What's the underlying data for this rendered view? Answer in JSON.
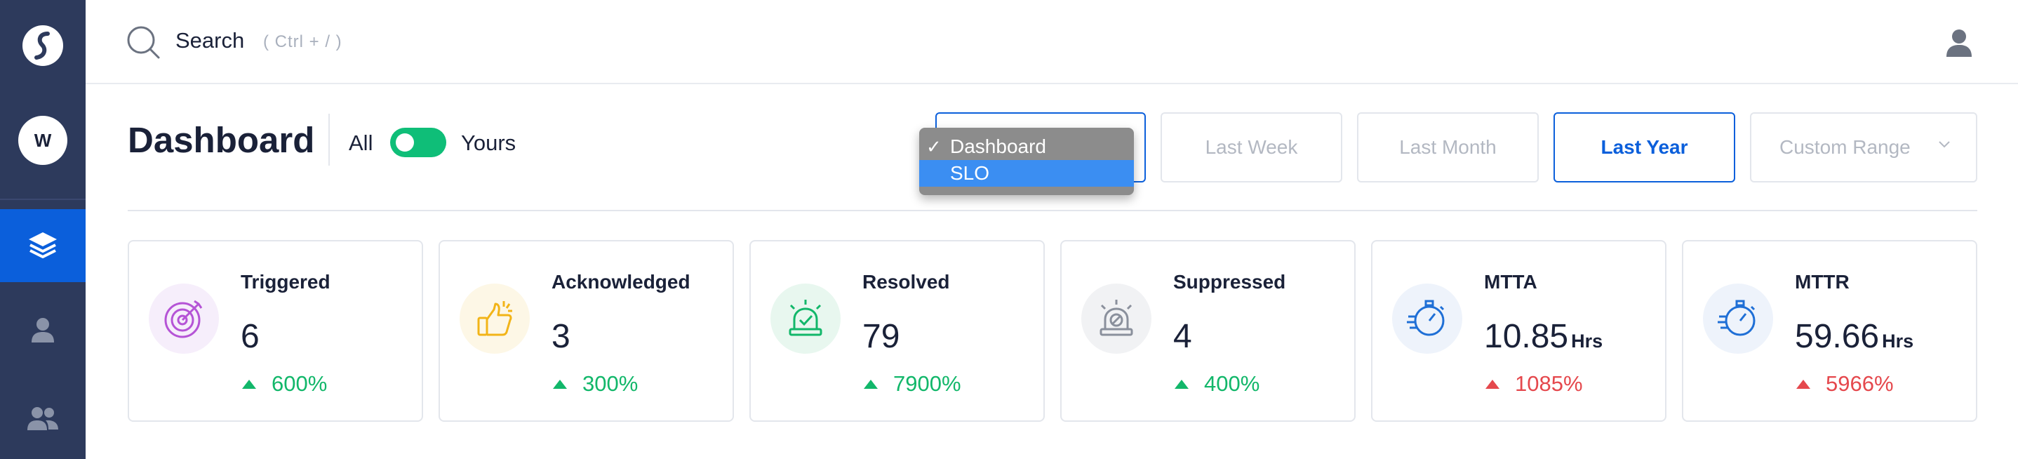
{
  "sidebar": {
    "logo_icon": "brand-logo-icon",
    "workspace_initial": "W",
    "items": [
      {
        "icon": "layers-icon",
        "active": true
      },
      {
        "icon": "user-icon",
        "active": false
      },
      {
        "icon": "users-icon",
        "active": false
      }
    ]
  },
  "search": {
    "label": "Search",
    "shortcut_hint": "( Ctrl + / )"
  },
  "header": {
    "title": "Dashboard",
    "toggle_left": "All",
    "toggle_right": "Yours",
    "toggle_on": true
  },
  "dashboard_select": {
    "options": [
      "Dashboard",
      "SLO"
    ],
    "selected": "Dashboard",
    "highlighted": "SLO"
  },
  "time_ranges": [
    {
      "label": "Last Week",
      "active": false
    },
    {
      "label": "Last Month",
      "active": false
    },
    {
      "label": "Last Year",
      "active": true
    },
    {
      "label": "Custom Range",
      "active": false
    }
  ],
  "metrics": [
    {
      "label": "Triggered",
      "value": "6",
      "unit": "",
      "change": "600%",
      "trend": "up",
      "change_color": "#12b76a",
      "icon": "target-icon",
      "icon_color": "#b554d6",
      "icon_bg": "#f6eefb"
    },
    {
      "label": "Acknowledged",
      "value": "3",
      "unit": "",
      "change": "300%",
      "trend": "up",
      "change_color": "#12b76a",
      "icon": "thumbs-up-icon",
      "icon_color": "#f2b418",
      "icon_bg": "#fdf7e6"
    },
    {
      "label": "Resolved",
      "value": "79",
      "unit": "",
      "change": "7900%",
      "trend": "up",
      "change_color": "#12b76a",
      "icon": "siren-check-icon",
      "icon_color": "#12b76a",
      "icon_bg": "#e8f7ef"
    },
    {
      "label": "Suppressed",
      "value": "4",
      "unit": "",
      "change": "400%",
      "trend": "up",
      "change_color": "#12b76a",
      "icon": "siren-blocked-icon",
      "icon_color": "#8a909c",
      "icon_bg": "#f1f2f4"
    },
    {
      "label": "MTTA",
      "value": "10.85",
      "unit": "Hrs",
      "change": "1085%",
      "trend": "up",
      "change_color": "#e5484d",
      "icon": "stopwatch-icon",
      "icon_color": "#1f6fd6",
      "icon_bg": "#eef3fb"
    },
    {
      "label": "MTTR",
      "value": "59.66",
      "unit": "Hrs",
      "change": "5966%",
      "trend": "up",
      "change_color": "#e5484d",
      "icon": "stopwatch-icon",
      "icon_color": "#1f6fd6",
      "icon_bg": "#eef3fb"
    }
  ]
}
